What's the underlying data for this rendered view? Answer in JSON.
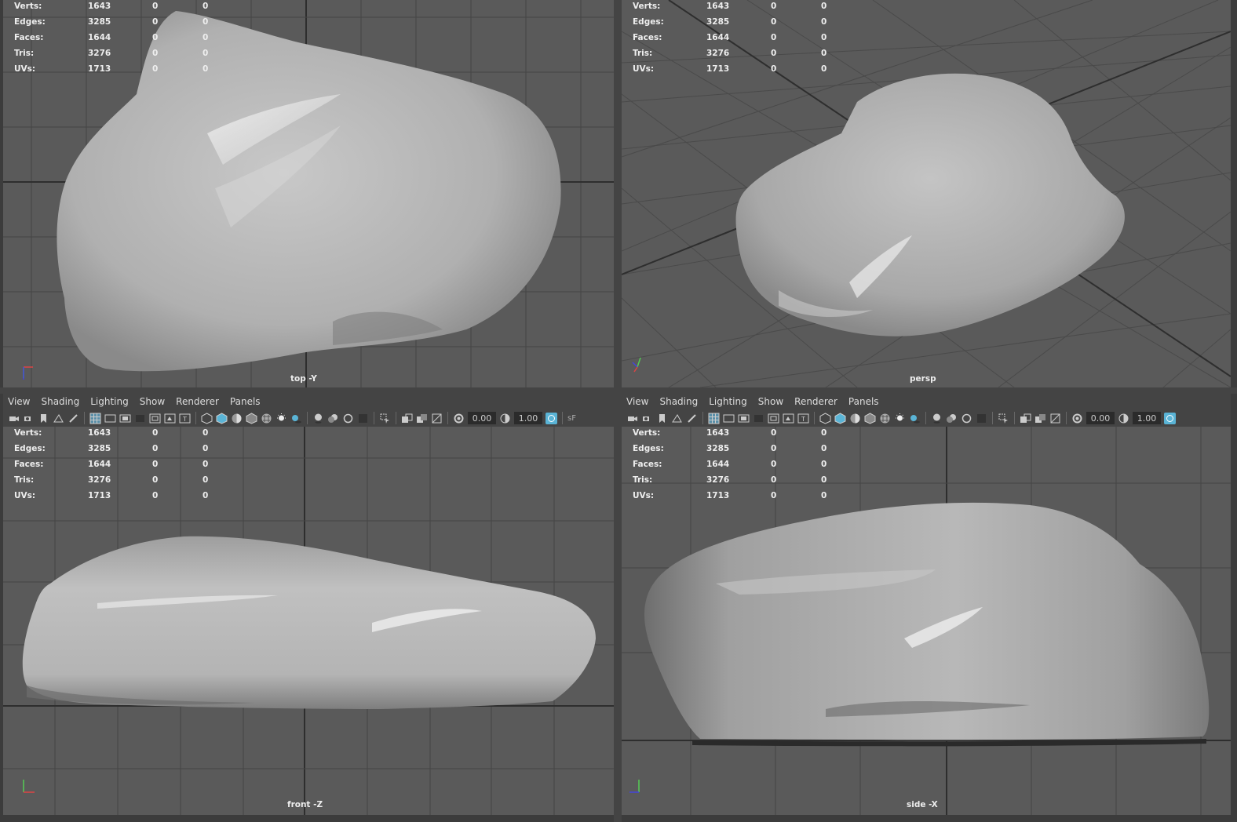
{
  "stats": {
    "rows": [
      {
        "label": "Verts:",
        "v1": "1643",
        "v2": "0",
        "v3": "0"
      },
      {
        "label": "Edges:",
        "v1": "3285",
        "v2": "0",
        "v3": "0"
      },
      {
        "label": "Faces:",
        "v1": "1644",
        "v2": "0",
        "v3": "0"
      },
      {
        "label": "Tris:",
        "v1": "3276",
        "v2": "0",
        "v3": "0"
      },
      {
        "label": "UVs:",
        "v1": "1713",
        "v2": "0",
        "v3": "0"
      }
    ]
  },
  "viewports": {
    "top": {
      "camera": "top -Y"
    },
    "persp": {
      "camera": "persp"
    },
    "front": {
      "camera": "front -Z"
    },
    "side": {
      "camera": "side -X"
    }
  },
  "panel_menu": [
    "View",
    "Shading",
    "Lighting",
    "Show",
    "Renderer",
    "Panels"
  ],
  "toolbar": {
    "exposure": "0.00",
    "gamma": "1.00",
    "truncated_label": "sF"
  },
  "colors": {
    "viewport_bg": "#5a5a5a",
    "grid_line": "#3e3e3e",
    "mesh": "#b5b5b5",
    "accent": "#5ab4d6"
  },
  "icons": [
    "camera-icon",
    "camera-attributes-icon",
    "bookmark-icon",
    "image-plane-icon",
    "grease-pencil-icon",
    "grid-icon",
    "film-gate-icon",
    "resolution-gate-icon",
    "wireframe-icon",
    "smooth-shade-icon",
    "textured-icon",
    "lights-icon",
    "shadows-icon",
    "isolate-select-icon",
    "xray-icon",
    "exposure-icon",
    "gamma-icon",
    "color-management-icon"
  ]
}
